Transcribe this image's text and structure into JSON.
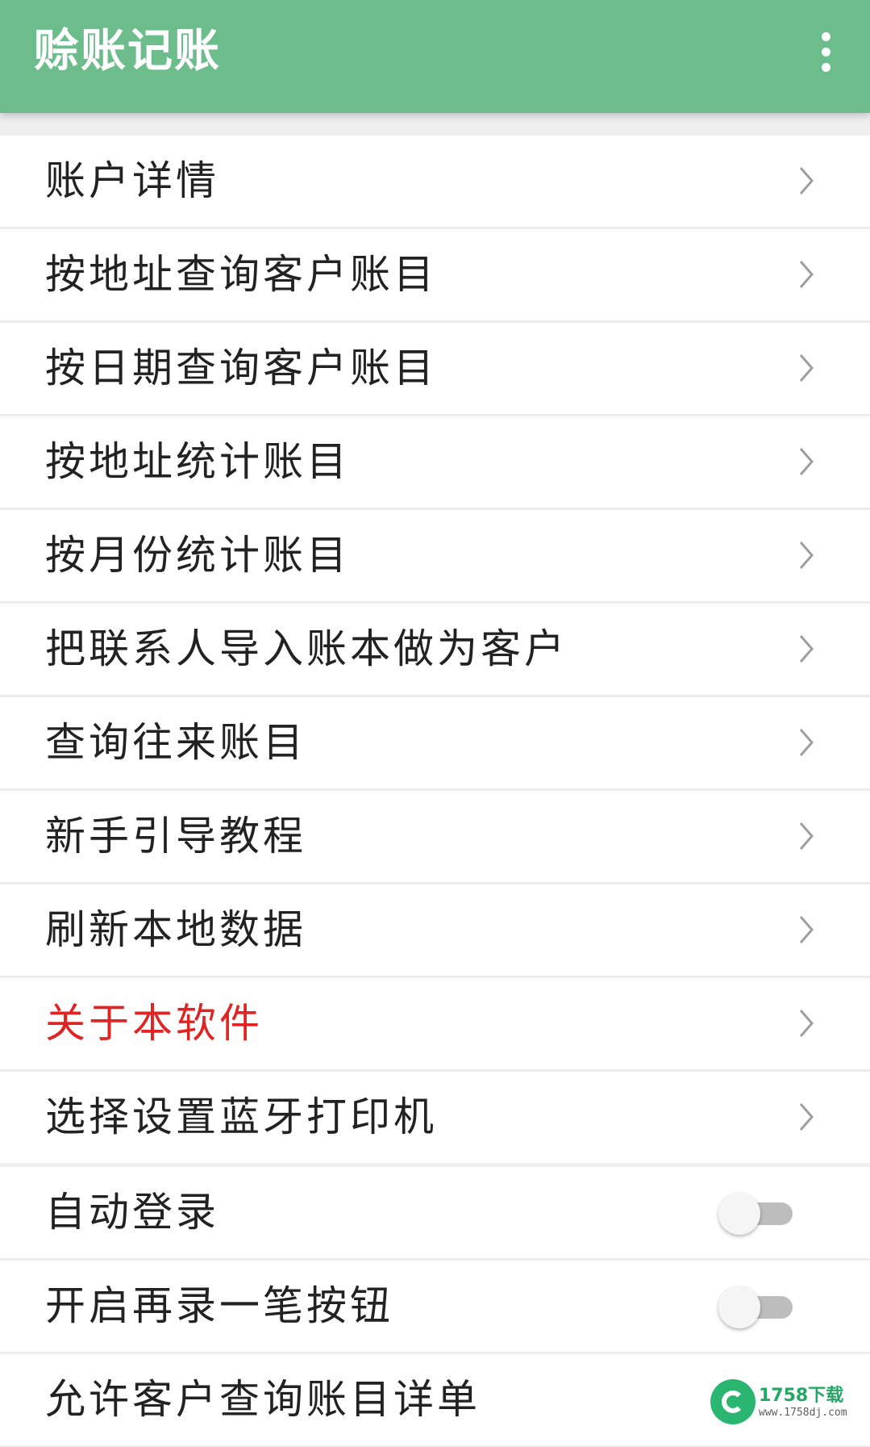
{
  "appbar": {
    "title": "赊账记账",
    "menu_icon": "more-vert-icon"
  },
  "menu_items": [
    {
      "label": "账户详情"
    },
    {
      "label": "按地址查询客户账目"
    },
    {
      "label": "按日期查询客户账目"
    },
    {
      "label": "按地址统计账目"
    },
    {
      "label": "按月份统计账目"
    },
    {
      "label": "把联系人导入账本做为客户"
    },
    {
      "label": "查询往来账目"
    },
    {
      "label": "新手引导教程"
    },
    {
      "label": "刷新本地数据"
    },
    {
      "label": "关于本软件",
      "color": "#e02424"
    },
    {
      "label": "选择设置蓝牙打印机"
    }
  ],
  "settings": [
    {
      "label": "自动登录",
      "on": false
    },
    {
      "label": "开启再录一笔按钮",
      "on": false
    },
    {
      "label": "允许客户查询账目详单"
    }
  ],
  "watermark": {
    "brand": "1758下载",
    "url": "www.1758dj.com"
  },
  "colors": {
    "appbar": "#6dbd8c",
    "highlight_text": "#e02424"
  }
}
